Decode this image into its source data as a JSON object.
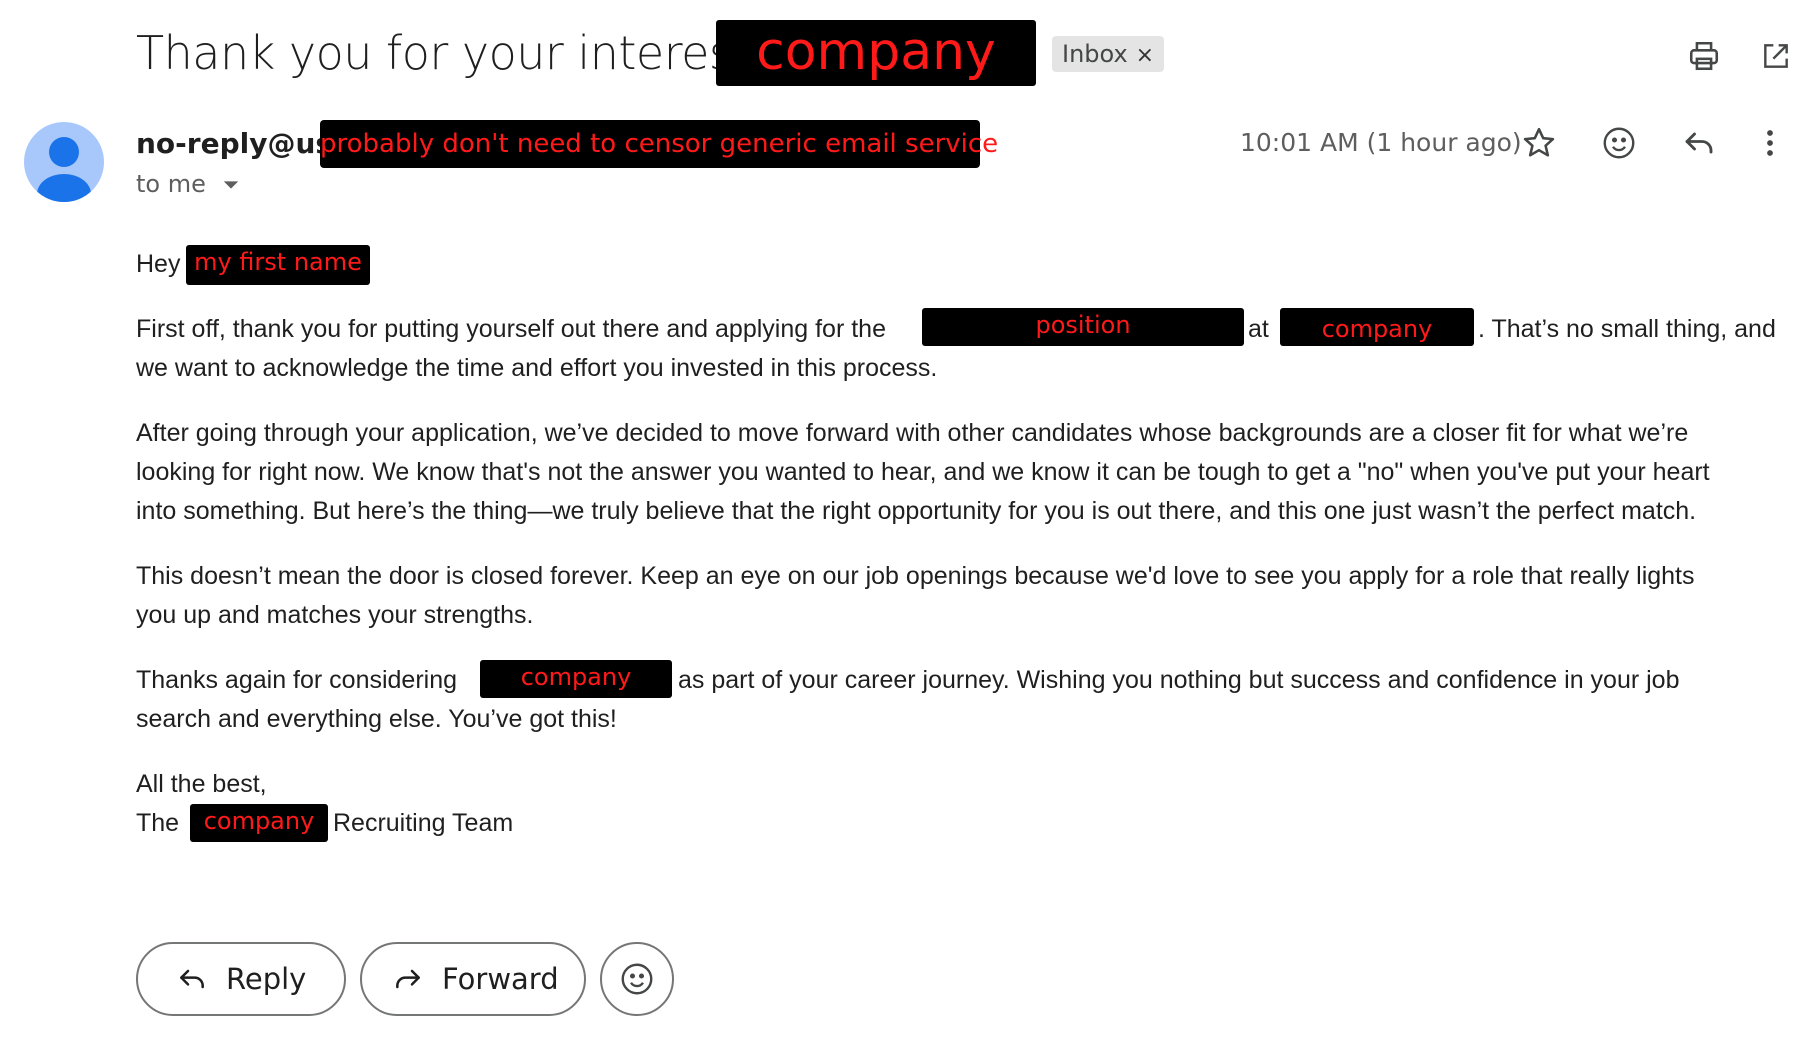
{
  "email": {
    "subject_prefix": "Thank you for your interest in",
    "subject_redaction": "company",
    "label_chip": "Inbox",
    "label_chip_close": "×",
    "sender_prefix": "no-reply@us.",
    "sender_redaction": "probably don't need to censor generic email service",
    "recipient": "to me",
    "timestamp": "10:01 AM (1 hour ago)"
  },
  "body": {
    "greeting": "Hey",
    "greeting_redaction": "my first name",
    "p1_start": "First off, thank you for putting yourself out there and applying for the",
    "p1_redaction_position": "position",
    "p1_at": "at",
    "p1_redaction_company": "company",
    "p1_end": ". That’s no small thing, and",
    "p1_line2": "we want to acknowledge the time and effort you invested in this process.",
    "p2_line1": "After going through your application, we’ve decided to move forward with other candidates whose backgrounds are a closer fit for what we’re",
    "p2_line2": "looking for right now. We know that's not the answer you wanted to hear, and we know it can be tough to get a \"no\" when you've put your heart",
    "p2_line3": "into something. But here’s the thing—we truly believe that the right opportunity for you is out there, and this one just wasn’t the perfect match.",
    "p3_line1": "This doesn’t mean the door is closed forever. Keep an eye on our job openings because we'd love to see you apply for a role that really lights",
    "p3_line2": "you up and matches your strengths.",
    "p4_start": "Thanks again for considering",
    "p4_redaction": "company",
    "p4_end": "as part of your career journey. Wishing you nothing but success and confidence in your job",
    "p4_line2": "search and everything else. You’ve got this!",
    "signoff": "All the best,",
    "sig_the": "The",
    "sig_redaction": "company",
    "sig_end": "Recruiting Team"
  },
  "actions": {
    "reply": "Reply",
    "forward": "Forward"
  },
  "icons": [
    "print-icon",
    "open-in-new-window-icon",
    "star-icon",
    "emoji-icon",
    "reply-icon",
    "more-vert-icon",
    "avatar-icon",
    "chevron-down-icon",
    "forward-icon"
  ],
  "colors": {
    "redaction_bg": "#000000",
    "redaction_text": "#ff1a1a",
    "chip_bg": "#e4e4e4",
    "avatar_bg": "#a8c7fa",
    "avatar_fg": "#1a73e8"
  }
}
